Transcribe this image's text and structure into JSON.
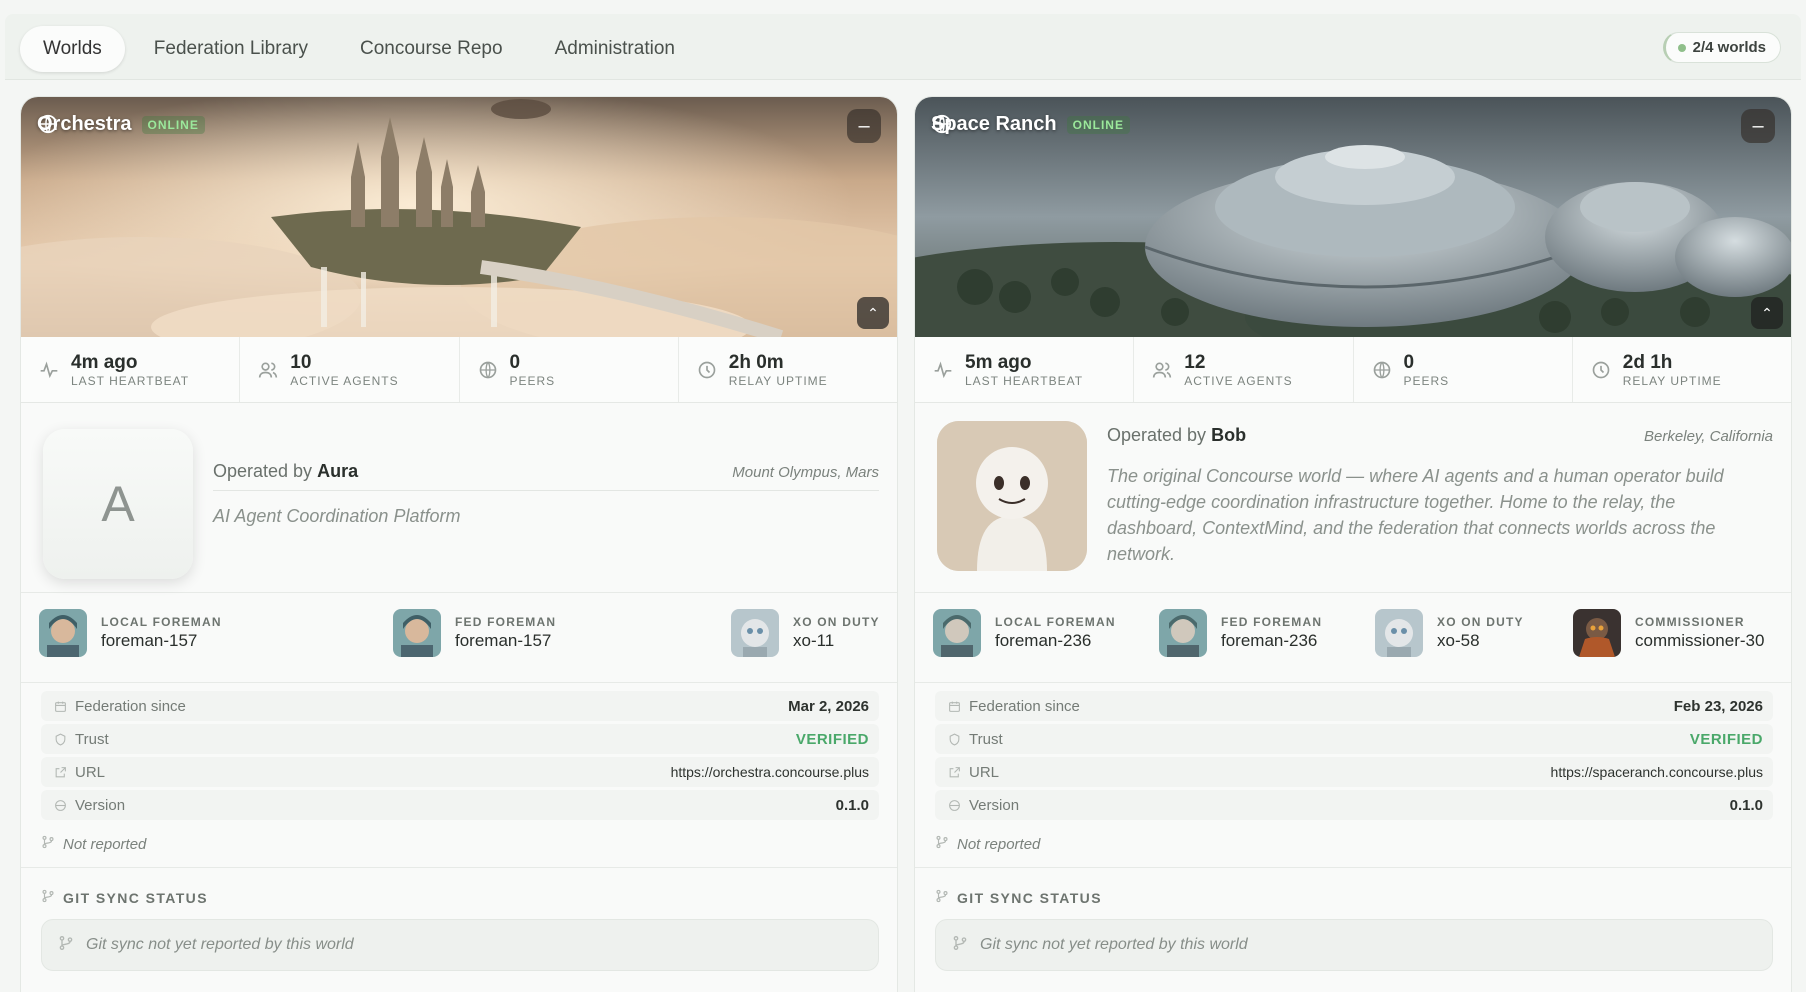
{
  "tabs": [
    {
      "label": "Worlds",
      "active": true
    },
    {
      "label": "Federation Library",
      "active": false
    },
    {
      "label": "Concourse Repo",
      "active": false
    },
    {
      "label": "Administration",
      "active": false
    }
  ],
  "worlds_badge": "2/4 worlds",
  "worlds": [
    {
      "name": "Orchestra",
      "status": "ONLINE",
      "stats": [
        {
          "value": "4m ago",
          "label": "LAST HEARTBEAT",
          "icon": "pulse-icon"
        },
        {
          "value": "10",
          "label": "ACTIVE AGENTS",
          "icon": "users-icon"
        },
        {
          "value": "0",
          "label": "PEERS",
          "icon": "globe-icon"
        },
        {
          "value": "2h 0m",
          "label": "RELAY UPTIME",
          "icon": "clock-icon"
        }
      ],
      "avatar_letter": "A",
      "operated_by_prefix": "Operated by",
      "operator": "Aura",
      "location": "Mount Olympus, Mars",
      "tagline": "AI Agent Coordination Platform",
      "foremen": [
        {
          "role": "LOCAL FOREMAN",
          "id": "foreman-157"
        },
        {
          "role": "FED FOREMAN",
          "id": "foreman-157"
        },
        {
          "role": "XO ON DUTY",
          "id": "xo-11"
        }
      ],
      "info": [
        {
          "key": "Federation since",
          "value": "Mar 2, 2026",
          "icon": "calendar-icon"
        },
        {
          "key": "Trust",
          "value": "VERIFIED",
          "icon": "shield-icon"
        },
        {
          "key": "URL",
          "value": "https://orchestra.concourse.plus",
          "icon": "external-link-icon"
        },
        {
          "key": "Version",
          "value": "0.1.0",
          "icon": "globe-icon"
        }
      ],
      "not_reported": "Not reported",
      "git_header": "GIT SYNC STATUS",
      "git_message": "Git sync not yet reported by this world"
    },
    {
      "name": "Space Ranch",
      "status": "ONLINE",
      "stats": [
        {
          "value": "5m ago",
          "label": "LAST HEARTBEAT",
          "icon": "pulse-icon"
        },
        {
          "value": "12",
          "label": "ACTIVE AGENTS",
          "icon": "users-icon"
        },
        {
          "value": "0",
          "label": "PEERS",
          "icon": "globe-icon"
        },
        {
          "value": "2d 1h",
          "label": "RELAY UPTIME",
          "icon": "clock-icon"
        }
      ],
      "operated_by_prefix": "Operated by",
      "operator": "Bob",
      "location": "Berkeley, California",
      "tagline": "The original Concourse world — where AI agents and a human operator build cutting-edge coordination infrastructure together. Home to the relay, the dashboard, ContextMind, and the federation that connects worlds across the network.",
      "foremen": [
        {
          "role": "LOCAL FOREMAN",
          "id": "foreman-236"
        },
        {
          "role": "FED FOREMAN",
          "id": "foreman-236"
        },
        {
          "role": "XO ON DUTY",
          "id": "xo-58"
        },
        {
          "role": "COMMISSIONER",
          "id": "commissioner-30"
        }
      ],
      "info": [
        {
          "key": "Federation since",
          "value": "Feb 23, 2026",
          "icon": "calendar-icon"
        },
        {
          "key": "Trust",
          "value": "VERIFIED",
          "icon": "shield-icon"
        },
        {
          "key": "URL",
          "value": "https://spaceranch.concourse.plus",
          "icon": "external-link-icon"
        },
        {
          "key": "Version",
          "value": "0.1.0",
          "icon": "globe-icon"
        }
      ],
      "not_reported": "Not reported",
      "git_header": "GIT SYNC STATUS",
      "git_message": "Git sync not yet reported by this world"
    }
  ]
}
